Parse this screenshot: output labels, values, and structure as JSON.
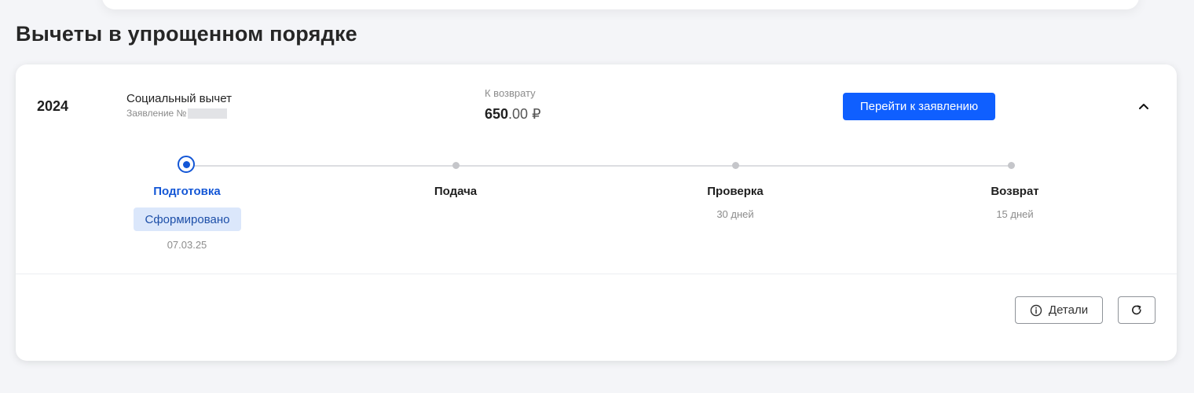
{
  "section": {
    "title": "Вычеты в упрощенном порядке"
  },
  "card": {
    "year": "2024",
    "deduction_type": "Социальный вычет",
    "application_label": "Заявление №",
    "refund": {
      "label": "К возврату",
      "amount_whole": "650",
      "amount_decimals": ".00 ₽"
    },
    "goto_button_label": "Перейти к заявлению",
    "collapse_icon": "chevron-up-icon"
  },
  "steps": [
    {
      "label": "Подготовка",
      "status": "Сформировано",
      "date": "07.03.25",
      "active": true
    },
    {
      "label": "Подача"
    },
    {
      "label": "Проверка",
      "duration": "30 дней"
    },
    {
      "label": "Возврат",
      "duration": "15 дней"
    }
  ],
  "footer": {
    "details_label": "Детали",
    "details_icon": "info-icon",
    "refresh_icon": "refresh-icon"
  },
  "colors": {
    "accent": "#0f5fff",
    "active_step": "#1457d6",
    "badge_bg": "#dbe7fb"
  }
}
